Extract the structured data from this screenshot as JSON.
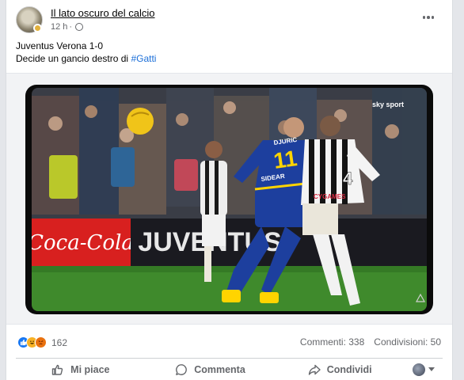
{
  "post": {
    "author": "Il lato oscuro del calcio",
    "time": "12 h",
    "separator": "·",
    "text_line1": "Juventus Verona 1-0",
    "text_line2_prefix": "Decide un gancio destro di",
    "hashtag": "#Gatti",
    "video": {
      "ad_board_left": "Coca-Cola",
      "ad_board_right": "JUVENTUS",
      "broadcaster": "sky sport",
      "player_verona_number": "11",
      "player_verona_name": "DJURIC",
      "player_verona_sponsor": "SIDEAR",
      "player_juve_number": "4",
      "player_juve_sponsor": "CYGAMES"
    }
  },
  "stats": {
    "reactions": [
      "like",
      "haha",
      "angry"
    ],
    "reaction_count": "162",
    "comments": "Commenti: 338",
    "shares": "Condivisioni: 50"
  },
  "actions": {
    "like": "Mi piace",
    "comment": "Commenta",
    "share": "Condividi"
  },
  "colors": {
    "accent": "#1877f2",
    "hashtag": "#1a6ed8",
    "secondary_text": "#65676b"
  }
}
